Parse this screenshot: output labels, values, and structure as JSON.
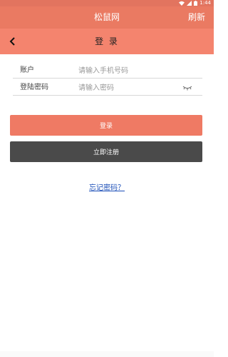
{
  "status_bar": {
    "time": "1:44"
  },
  "app_bar": {
    "title": "松鼠网",
    "refresh_label": "刷新"
  },
  "sub_header": {
    "title": "登 录"
  },
  "form": {
    "account": {
      "label": "账户",
      "placeholder": "请输入手机号码",
      "value": ""
    },
    "password": {
      "label": "登陆密码",
      "placeholder": "请输入密码",
      "value": ""
    }
  },
  "buttons": {
    "login_label": "登录",
    "register_label": "立即注册"
  },
  "forgot_password_label": "忘记密码？",
  "colors": {
    "status_bar": "#e2745f",
    "app_bar": "#ea7a62",
    "sub_header": "#f4846e",
    "login_button": "#ef7a64",
    "register_button": "#4a4a4a",
    "link": "#1c4fb8"
  },
  "icons": [
    "wifi-icon",
    "signal-icon",
    "battery-icon",
    "back-arrow-icon",
    "eye-closed-icon"
  ]
}
